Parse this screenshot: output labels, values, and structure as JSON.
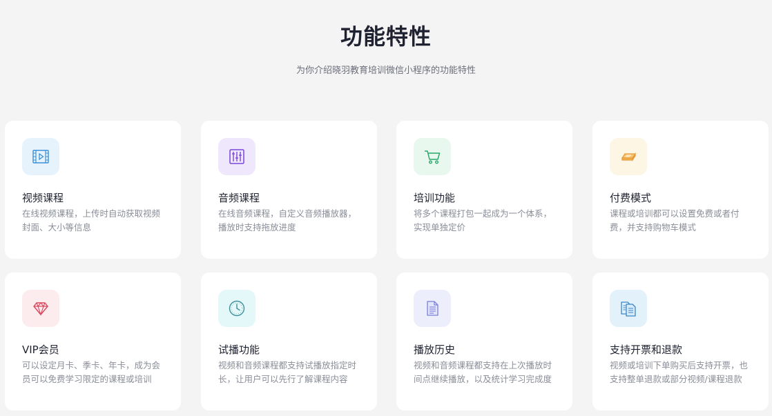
{
  "header": {
    "title": "功能特性",
    "subtitle": "为你介绍晓羽教育培训微信小程序的功能特性"
  },
  "features": [
    {
      "title": "视频课程",
      "desc": "在线视频课程，上传时自动获取视频封面、大小等信息",
      "icon": "video-icon",
      "color": "#3b8fd6",
      "bg": "#e6f3fd"
    },
    {
      "title": "音频课程",
      "desc": "在线音频课程，自定义音频播放器，播放时支持拖放进度",
      "icon": "equalizer-icon",
      "color": "#7a45d8",
      "bg": "#efe8fc"
    },
    {
      "title": "培训功能",
      "desc": "将多个课程打包一起成为一个体系，实现单独定价",
      "icon": "cart-icon",
      "color": "#2aa86a",
      "bg": "#e8f8ef"
    },
    {
      "title": "付费模式",
      "desc": "课程或培训都可以设置免费或者付费，并支持购物车模式",
      "icon": "money-icon",
      "color": "#e89a3a",
      "bg": "#fdf6e4"
    },
    {
      "title": "VIP会员",
      "desc": "可以设定月卡、季卡、年卡，成为会员可以免费学习限定的课程或培训",
      "icon": "diamond-icon",
      "color": "#d9455b",
      "bg": "#fdecee"
    },
    {
      "title": "试播功能",
      "desc": "视频和音频课程都支持试播放指定时长，让用户可以先行了解课程内容",
      "icon": "clock-icon",
      "color": "#3f8f9a",
      "bg": "#e4f8f9"
    },
    {
      "title": "播放历史",
      "desc": "视频和音频课程都支持在上次播放时间点继续播放，以及统计学习完成度",
      "icon": "document-icon",
      "color": "#7b7fd8",
      "bg": "#eceefc"
    },
    {
      "title": "支持开票和退款",
      "desc": "视频或培训下单购买后支持开票，也支持整单退款或部分视频/课程退款",
      "icon": "invoice-icon",
      "color": "#3a86c8",
      "bg": "#e3f1fb"
    }
  ]
}
